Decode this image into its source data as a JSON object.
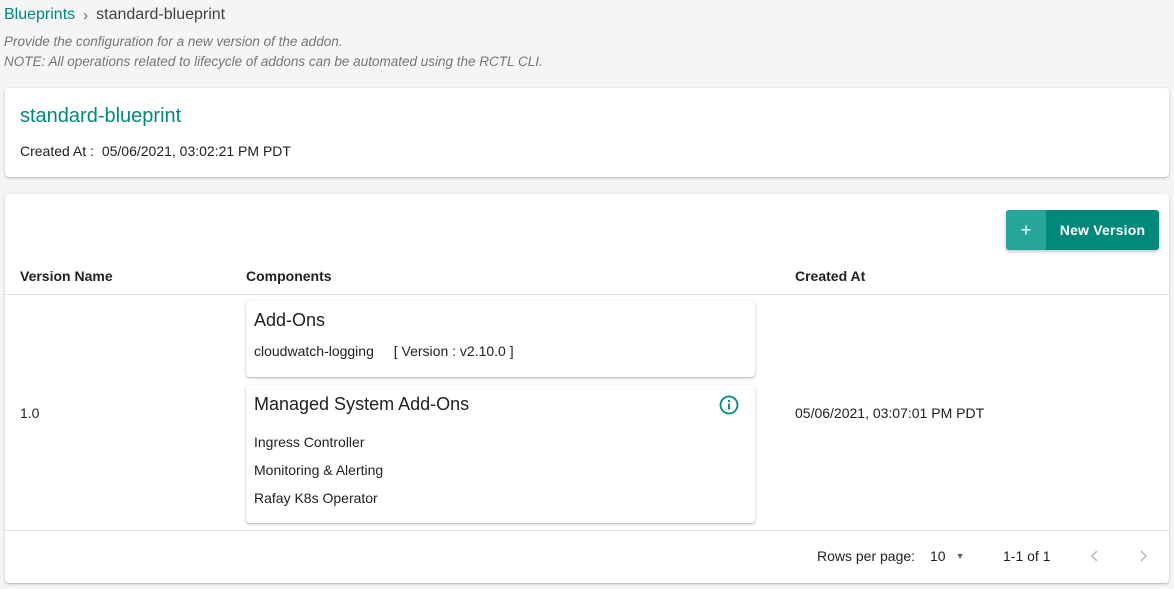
{
  "breadcrumb": {
    "parent": "Blueprints",
    "separator": "›",
    "current": "standard-blueprint"
  },
  "description": {
    "line1": "Provide the configuration for a new version of the addon.",
    "line2": "NOTE: All operations related to lifecycle of addons can be automated using the RCTL CLI."
  },
  "blueprint": {
    "name": "standard-blueprint",
    "created_label": "Created At :",
    "created_value": "05/06/2021, 03:02:21 PM PDT"
  },
  "toolbar": {
    "plus": "+",
    "new_version_label": "New Version"
  },
  "table": {
    "headers": {
      "version": "Version Name",
      "components": "Components",
      "created": "Created At"
    },
    "rows": [
      {
        "version": "1.0",
        "created": "05/06/2021, 03:07:01 PM PDT",
        "addons": {
          "title": "Add-Ons",
          "items": [
            {
              "name": "cloudwatch-logging",
              "version": "[ Version : v2.10.0 ]"
            }
          ]
        },
        "managed": {
          "title": "Managed System Add-Ons",
          "items": [
            "Ingress Controller",
            "Monitoring & Alerting",
            "Rafay K8s Operator"
          ]
        }
      }
    ]
  },
  "pagination": {
    "rows_label": "Rows per page:",
    "rows_value": "10",
    "range": "1-1 of 1"
  },
  "icons": {
    "info": "info-icon",
    "prev": "chevron-left-icon",
    "next": "chevron-right-icon",
    "dropdown": "caret-down-icon"
  },
  "colors": {
    "accent": "#00897b",
    "accent_light": "#26a69a"
  }
}
